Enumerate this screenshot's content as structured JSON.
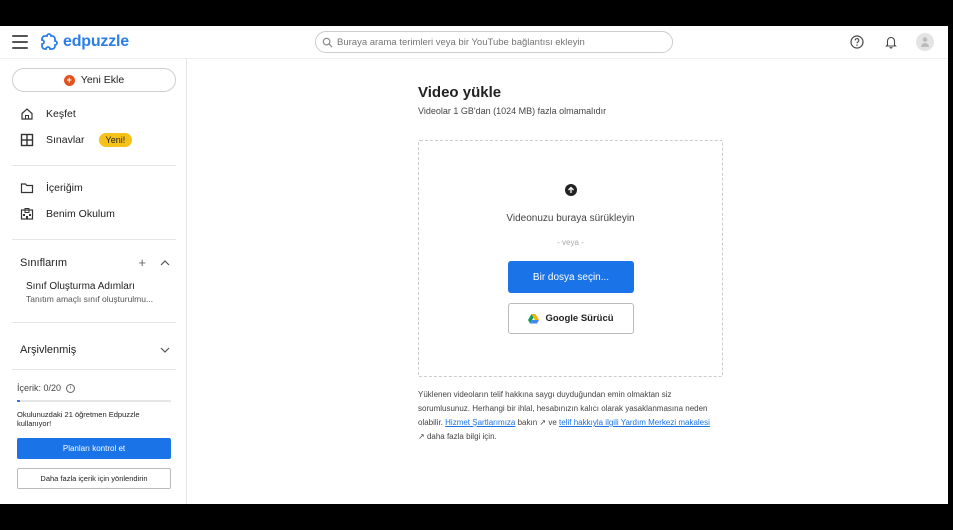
{
  "header": {
    "brand": "edpuzzle",
    "search_placeholder": "Buraya arama terimleri veya bir YouTube bağlantısı ekleyin"
  },
  "sidebar": {
    "new_button": "Yeni Ekle",
    "nav": [
      {
        "label": "Keşfet"
      },
      {
        "label": "Sınavlar",
        "badge": "Yeni!"
      },
      {
        "label": "İçeriğim"
      },
      {
        "label": "Benim Okulum"
      }
    ],
    "classes_header": "Sınıflarım",
    "class_item": {
      "title": "Sınıf Oluşturma Adımları",
      "subtitle": "Tanıtım amaçlı sınıf oluşturulmu..."
    },
    "archived_header": "Arşivlenmiş",
    "content_count": "İçerik: 0/20",
    "content_progress": 0,
    "teacher_note": "Okulunuzdaki 21 öğretmen Edpuzzle kullanıyor!",
    "plans_button": "Planları kontrol et",
    "more_button": "Daha fazla içerik için yönlendirin"
  },
  "main": {
    "title": "Video yükle",
    "subtitle": "Videolar 1 GB'dan (1024 MB) fazla olmamalıdır",
    "drag_text": "Videonuzu buraya sürükleyin",
    "or_text": "- veya -",
    "choose_button": "Bir dosya seçin...",
    "drive_button": "Google Sürücü",
    "legal": {
      "text1": "Yüklenen videoların telif hakkına saygı duyduğundan emin olmaktan siz sorumlusunuz. Herhangi bir ihlal, hesabınızın kalıcı olarak yasaklanmasına neden olabilir.",
      "link1": "Hizmet Şartlarımıza",
      "text2": "bakın",
      "text3": "ve",
      "link2": "telif hakkıyla ilgili Yardım Merkezi makalesi",
      "text4": "daha fazla bilgi için."
    }
  },
  "colors": {
    "brand_blue": "#1b73e8",
    "badge_yellow": "#f6c21a",
    "new_orange": "#e0531e"
  }
}
